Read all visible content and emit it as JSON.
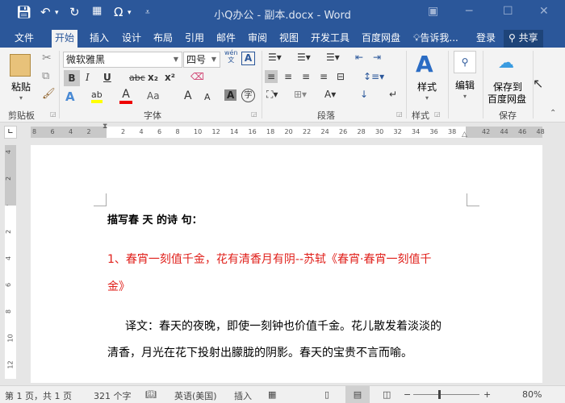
{
  "titlebar": {
    "title": "小Q办公 - 副本.docx - Word",
    "undo_icon": "undo-icon",
    "redo_icon": "redo-icon"
  },
  "tabs": [
    "文件",
    "开始",
    "插入",
    "设计",
    "布局",
    "引用",
    "邮件",
    "审阅",
    "视图",
    "开发工具",
    "百度网盘"
  ],
  "tell_me": "告诉我...",
  "login": "登录",
  "share": "共享",
  "ribbon": {
    "clipboard": {
      "paste": "粘贴",
      "group": "剪贴板"
    },
    "font": {
      "name": "微软雅黑",
      "size": "四号",
      "group": "字体",
      "wen": "wén",
      "wen_sub": "文",
      "bold": "B",
      "italic": "I",
      "underline": "U",
      "strike": "abc",
      "sub": "x₂",
      "sup": "x²",
      "aa": "Aa",
      "grow": "A",
      "shrink": "A",
      "char_shade": "A",
      "enclose": "字"
    },
    "paragraph": {
      "group": "段落"
    },
    "styles": {
      "label": "样式",
      "group": "样式"
    },
    "edit": {
      "label": "编辑"
    },
    "save": {
      "label1": "保存到",
      "label2": "百度网盘",
      "group": "保存"
    }
  },
  "ruler": {
    "left": [
      "8",
      "6",
      "4",
      "2"
    ],
    "main": [
      "2",
      "4",
      "6",
      "8",
      "10",
      "12",
      "14",
      "16",
      "18",
      "20",
      "22",
      "24",
      "26",
      "28",
      "30",
      "32",
      "34",
      "36",
      "38"
    ],
    "right": [
      "42",
      "44",
      "46",
      "48"
    ],
    "vertical": [
      "4",
      "2",
      "",
      "2",
      "4",
      "6",
      "8",
      "10",
      "12"
    ]
  },
  "document": {
    "heading": "描写春 天 的诗 句：",
    "red_line1": "1、春宵一刻值千金，花有清香月有阴--苏轼《春宵·春宵一刻值千",
    "red_line2": "金》",
    "body_line1": "译文：春天的夜晚，即使一刻钟也价值千金。花儿散发着淡淡的",
    "body_line2": "清香，月光在花下投射出朦胧的阴影。春天的宝贵不言而喻。"
  },
  "status": {
    "page": "第 1 页，共 1 页",
    "words": "321 个字",
    "language": "英语(美国)",
    "mode": "插入",
    "zoom": "80%",
    "zoom_percent": 80
  },
  "colors": {
    "brand": "#2b579a",
    "red_text": "#e0201b"
  }
}
